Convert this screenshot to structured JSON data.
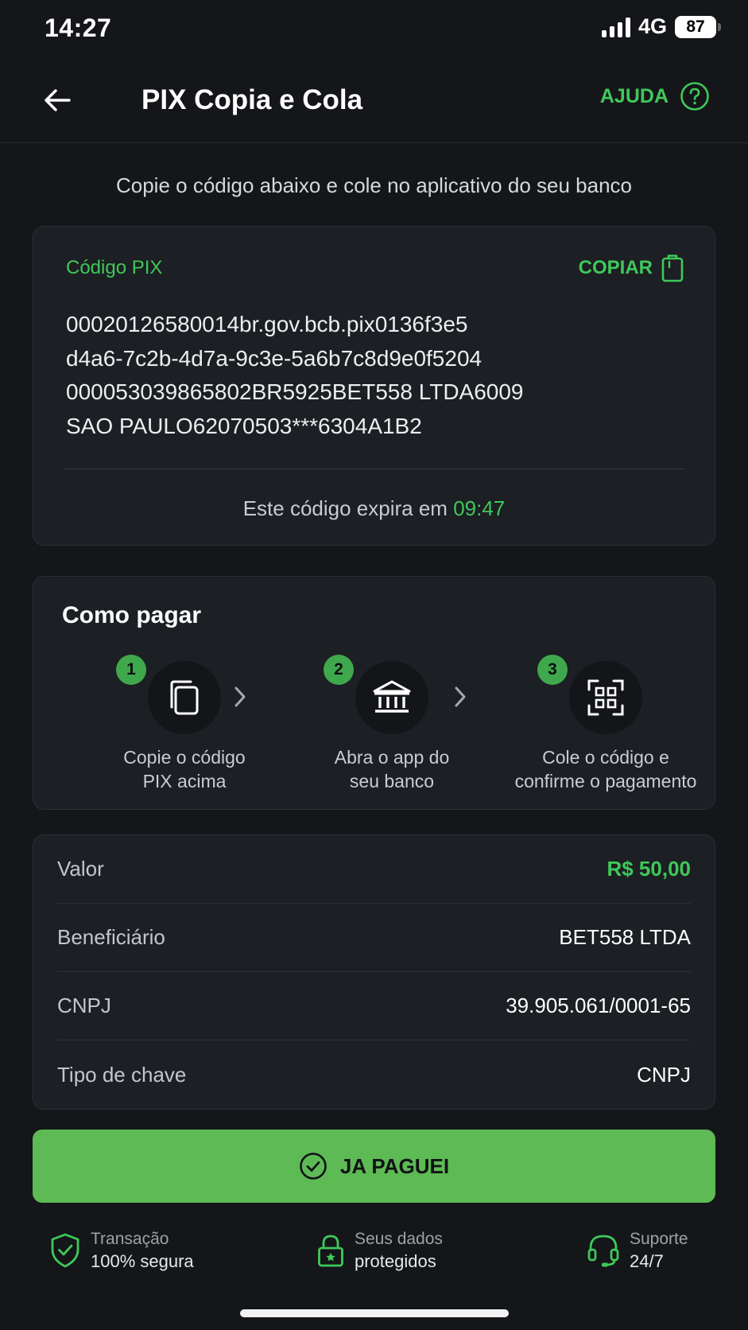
{
  "status": {
    "time": "14:27",
    "network": "4G",
    "battery": "87"
  },
  "header": {
    "title": "PIX Copia e Cola",
    "help_label": "AJUDA"
  },
  "instruction": "Copie o código abaixo e cole no aplicativo do seu banco",
  "code_card": {
    "label": "Código PIX",
    "copy_label": "COPIAR",
    "code_lines": [
      "00020126580014br.gov.bcb.pix0136f3e5",
      "d4a6-7c2b-4d7a-9c3e-5a6b7c8d9e0f5204",
      "000053039865802BR5925BET558 LTDA6009",
      "SAO PAULO62070503***6304A1B2"
    ],
    "expire_text": "Este código expira em",
    "expire_time": "09:47"
  },
  "how_to": {
    "title": "Como pagar",
    "steps": [
      {
        "number": "1",
        "line1": "Copie o código",
        "line2": "PIX acima",
        "icon": "copy-icon"
      },
      {
        "number": "2",
        "line1": "Abra o app do",
        "line2": "seu banco",
        "icon": "bank-icon"
      },
      {
        "number": "3",
        "line1": "Cole o código e",
        "line2": "confirme o pagamento",
        "icon": "qr-code-icon"
      }
    ]
  },
  "details": {
    "rows": [
      {
        "label": "Valor",
        "value": "R$ 50,00"
      },
      {
        "label": "Beneficiário",
        "value": "BET558 LTDA"
      },
      {
        "label": "CNPJ",
        "value": "39.905.061/0001-65"
      },
      {
        "label": "Tipo de chave",
        "value": "CNPJ"
      }
    ]
  },
  "paid_button": {
    "label": "JA PAGUEI"
  },
  "trust": [
    {
      "line1": "Transação",
      "line2": "100% segura",
      "icon": "shield-check-icon"
    },
    {
      "line1": "Seus dados",
      "line2": "protegidos",
      "icon": "lock-icon"
    },
    {
      "line1": "Suporte",
      "line2": "24/7",
      "icon": "headset-icon"
    }
  ],
  "colors": {
    "accent": "#3fc85a",
    "button": "#5dba54",
    "background": "#141619",
    "card": "#1c1f23"
  }
}
